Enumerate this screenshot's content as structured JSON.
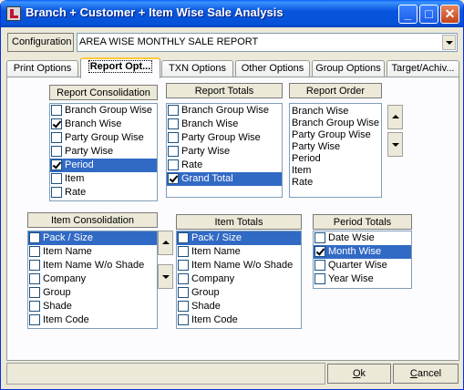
{
  "window": {
    "title": "Branch + Customer + Item Wise Sale Analysis"
  },
  "config": {
    "label": "Configuration",
    "value": "AREA WISE MONTHLY SALE REPORT"
  },
  "tabs": [
    {
      "label": "Print Options"
    },
    {
      "label": "Report Opt..."
    },
    {
      "label": "TXN Options"
    },
    {
      "label": "Other Options"
    },
    {
      "label": "Group Options"
    },
    {
      "label": "Target/Achiv..."
    }
  ],
  "report_consolidation": {
    "title": "Report Consolidation",
    "items": [
      {
        "label": "Branch Group Wise",
        "checked": false,
        "selected": false
      },
      {
        "label": "Branch Wise",
        "checked": true,
        "selected": false
      },
      {
        "label": "Party Group Wise",
        "checked": false,
        "selected": false
      },
      {
        "label": "Party Wise",
        "checked": false,
        "selected": false
      },
      {
        "label": "Period",
        "checked": true,
        "selected": true
      },
      {
        "label": "Item",
        "checked": false,
        "selected": false
      },
      {
        "label": "Rate",
        "checked": false,
        "selected": false
      }
    ]
  },
  "report_totals": {
    "title": "Report Totals",
    "items": [
      {
        "label": "Branch Group Wise",
        "checked": false,
        "selected": false
      },
      {
        "label": "Branch Wise",
        "checked": false,
        "selected": false
      },
      {
        "label": "Party Group Wise",
        "checked": false,
        "selected": false
      },
      {
        "label": "Party Wise",
        "checked": false,
        "selected": false
      },
      {
        "label": "Rate",
        "checked": false,
        "selected": false
      },
      {
        "label": "Grand Total",
        "checked": true,
        "selected": true
      }
    ]
  },
  "report_order": {
    "title": "Report Order",
    "items": [
      "Branch Wise",
      "Branch Group Wise",
      "Party Group Wise",
      "Party Wise",
      "Period",
      "Item",
      "Rate"
    ]
  },
  "item_consolidation": {
    "title": "Item Consolidation",
    "items": [
      {
        "label": "Pack / Size",
        "checked": false,
        "selected": true
      },
      {
        "label": "Item Name",
        "checked": false,
        "selected": false
      },
      {
        "label": "Item Name W/o Shade",
        "checked": false,
        "selected": false
      },
      {
        "label": "Company",
        "checked": false,
        "selected": false
      },
      {
        "label": "Group",
        "checked": false,
        "selected": false
      },
      {
        "label": "Shade",
        "checked": false,
        "selected": false
      },
      {
        "label": "Item Code",
        "checked": false,
        "selected": false
      }
    ]
  },
  "item_totals": {
    "title": "Item Totals",
    "items": [
      {
        "label": "Pack / Size",
        "checked": false,
        "selected": true
      },
      {
        "label": "Item Name",
        "checked": false,
        "selected": false
      },
      {
        "label": "Item Name W/o Shade",
        "checked": false,
        "selected": false
      },
      {
        "label": "Company",
        "checked": false,
        "selected": false
      },
      {
        "label": "Group",
        "checked": false,
        "selected": false
      },
      {
        "label": "Shade",
        "checked": false,
        "selected": false
      },
      {
        "label": "Item Code",
        "checked": false,
        "selected": false
      }
    ]
  },
  "period_totals": {
    "title": "Period Totals",
    "items": [
      {
        "label": "Date Wsie",
        "checked": false,
        "selected": false
      },
      {
        "label": "Month Wise",
        "checked": true,
        "selected": true
      },
      {
        "label": "Quarter Wise",
        "checked": false,
        "selected": false
      },
      {
        "label": "Year Wise",
        "checked": false,
        "selected": false
      }
    ]
  },
  "buttons": {
    "ok_underlined": "O",
    "ok_rest": "k",
    "cancel_underlined": "C",
    "cancel_rest": "ancel"
  },
  "colors": {
    "selection": "#316ac5",
    "titlebar": "#0855dd",
    "face": "#ece9d8",
    "active_tab_accent": "#ffc83c"
  }
}
